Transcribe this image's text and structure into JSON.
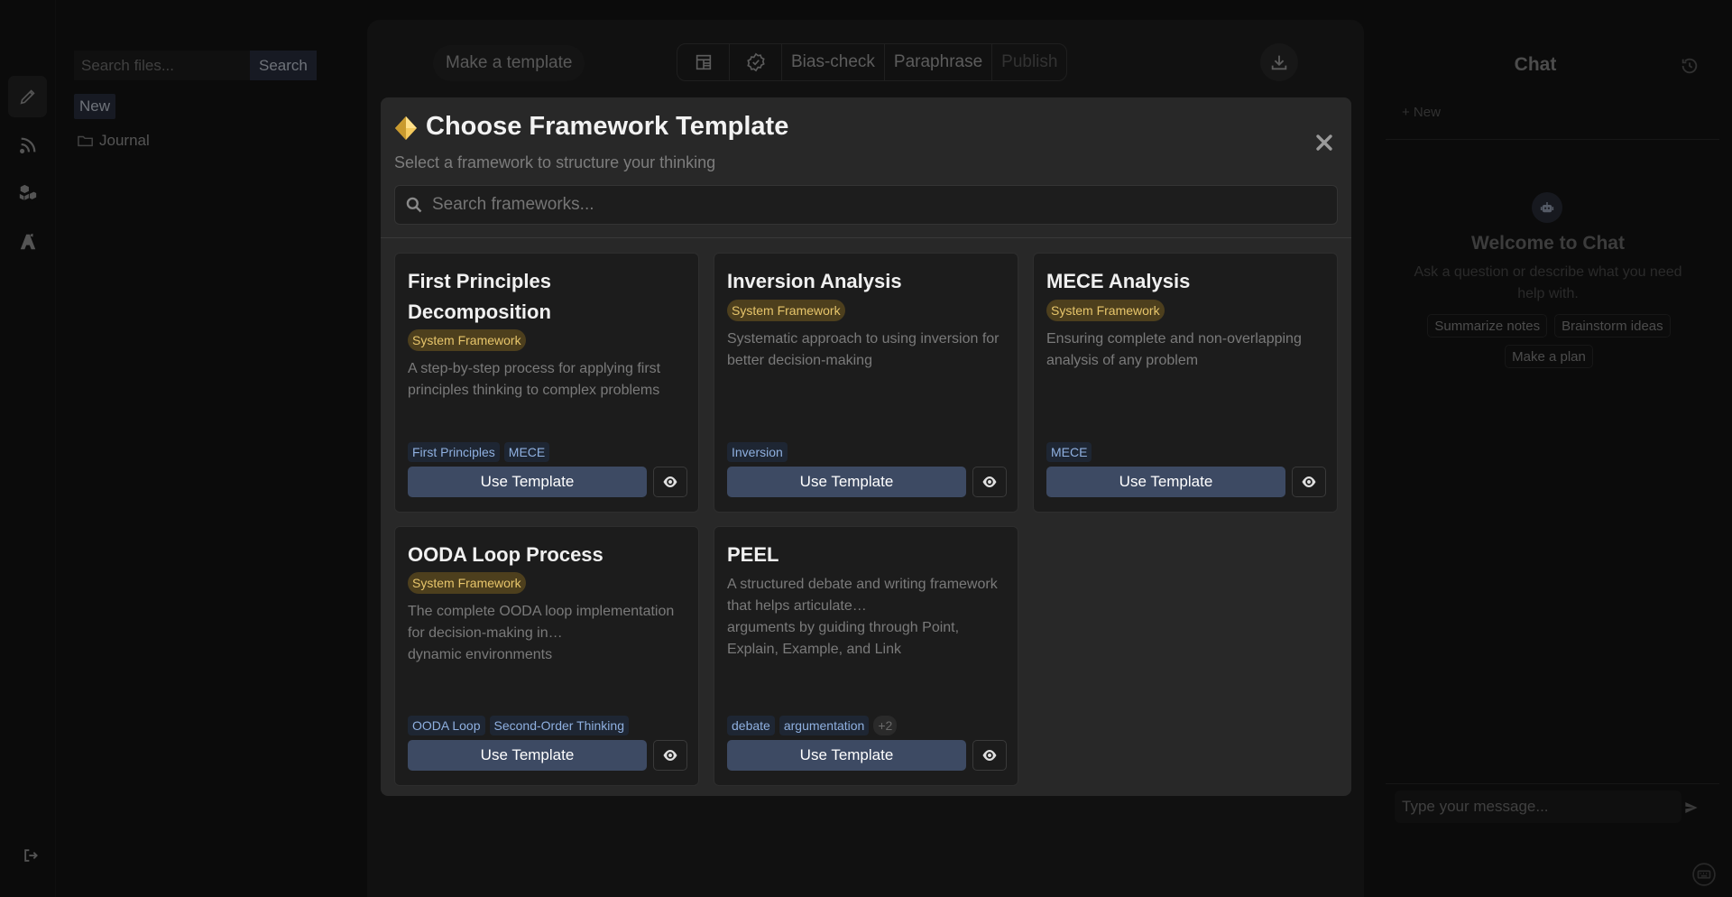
{
  "rail": {
    "items": [
      {
        "icon": "pencil-icon",
        "active": true
      },
      {
        "icon": "rss-icon",
        "active": false
      },
      {
        "icon": "boxes-icon",
        "active": false
      },
      {
        "icon": "school-icon",
        "active": false
      }
    ],
    "logout_icon": "logout-icon"
  },
  "files": {
    "search_placeholder": "Search files...",
    "search_label": "Search",
    "new_label": "New",
    "folders": [
      "Journal"
    ]
  },
  "editor": {
    "make_template_label": "Make a template",
    "toolbar": {
      "bias_check": "Bias-check",
      "paraphrase": "Paraphrase",
      "publish": "Publish"
    }
  },
  "chat": {
    "title": "Chat",
    "new_label": "+ New",
    "welcome_title": "Welcome to Chat",
    "welcome_sub": "Ask a question or describe what you need help with.",
    "suggestions": [
      "Summarize notes",
      "Brainstorm ideas",
      "Make a plan"
    ],
    "input_placeholder": "Type your message..."
  },
  "modal": {
    "title": "Choose Framework Template",
    "subtitle": "Select a framework to structure your thinking",
    "search_placeholder": "Search frameworks...",
    "use_label": "Use Template",
    "cards": [
      {
        "title": "First Principles Decomposition",
        "badge": "System Framework",
        "description": "A step-by-step process for applying first principles thinking to complex problems",
        "tags": [
          "First Principles",
          "MECE"
        ]
      },
      {
        "title": "Inversion Analysis",
        "badge": "System Framework",
        "description": "Systematic approach to using inversion for better decision-making",
        "tags": [
          "Inversion"
        ]
      },
      {
        "title": "MECE Analysis",
        "badge": "System Framework",
        "description": "Ensuring complete and non-overlapping analysis of any problem",
        "tags": [
          "MECE"
        ]
      },
      {
        "title": "OODA Loop Process",
        "badge": "System Framework",
        "description": "The complete OODA loop implementation for decision-making in…\ndynamic environments",
        "tags": [
          "OODA Loop",
          "Second-Order Thinking"
        ]
      },
      {
        "title": "PEEL",
        "badge": "",
        "description": "A structured debate and writing framework that helps articulate…\narguments by guiding through Point, Explain, Example, and Link",
        "tags": [
          "debate",
          "argumentation"
        ],
        "more_tags": "+2"
      }
    ]
  }
}
